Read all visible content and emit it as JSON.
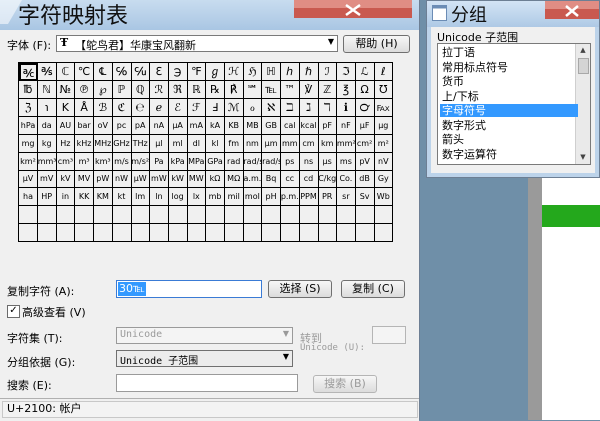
{
  "main_window": {
    "title": "字符映射表",
    "font_label": "字体 (F):",
    "font_icon": "Ŧ",
    "font_name": "【鸵鸟君】华康宝风翻新",
    "help_button": "帮助 (H)",
    "copy_label": "复制字符 (A):",
    "copy_value": "30℡",
    "select_button": "选择 (S)",
    "copy_button": "复制 (C)",
    "advanced_label": "高级查看 (V)",
    "advanced_checked": "✓",
    "charset_label": "字符集 (T):",
    "charset_value": "Unicode",
    "goto_label": "转到",
    "goto_sub": "Unicode (U):",
    "groupby_label": "分组依据 (G):",
    "groupby_value": "Unicode 子范围",
    "search_label": "搜索 (E):",
    "search_value": "",
    "search_button": "搜索 (B)",
    "status": "U+2100: 帐户"
  },
  "grid_chars": [
    "℀",
    "℁",
    "ℂ",
    "℃",
    "℄",
    "℅",
    "℆",
    "ℇ",
    "℈",
    "℉",
    "ℊ",
    "ℋ",
    "ℌ",
    "ℍ",
    "ℎ",
    "ℏ",
    "ℐ",
    "ℑ",
    "ℒ",
    "ℓ",
    "℔",
    "ℕ",
    "№",
    "℗",
    "℘",
    "ℙ",
    "ℚ",
    "ℛ",
    "ℜ",
    "ℝ",
    "℞",
    "℟",
    "℠",
    "℡",
    "™",
    "℣",
    "ℤ",
    "℥",
    "Ω",
    "℧",
    "ℨ",
    "℩",
    "K",
    "Å",
    "ℬ",
    "ℭ",
    "℮",
    "ℯ",
    "ℰ",
    "ℱ",
    "Ⅎ",
    "ℳ",
    "ℴ",
    "ℵ",
    "ℶ",
    "ℷ",
    "ℸ",
    "ℹ",
    "℺",
    "℻",
    "hPa",
    "da",
    "AU",
    "bar",
    "oV",
    "pc",
    "pA",
    "nA",
    "μA",
    "mA",
    "kA",
    "KB",
    "MB",
    "GB",
    "cal",
    "kcal",
    "pF",
    "nF",
    "μF",
    "μg",
    "mg",
    "kg",
    "Hz",
    "kHz",
    "MHz",
    "GHz",
    "THz",
    "μl",
    "ml",
    "dl",
    "kl",
    "fm",
    "nm",
    "μm",
    "mm",
    "cm",
    "km",
    "mm²",
    "cm²",
    "m²",
    "km²",
    "mm³",
    "cm³",
    "m³",
    "km³",
    "m/s",
    "m/s²",
    "Pa",
    "kPa",
    "MPa",
    "GPa",
    "rad",
    "rad/s",
    "rad/s²",
    "ps",
    "ns",
    "μs",
    "ms",
    "pV",
    "nV",
    "μV",
    "mV",
    "kV",
    "MV",
    "pW",
    "nW",
    "μW",
    "mW",
    "kW",
    "MW",
    "kΩ",
    "MΩ",
    "a.m.",
    "Bq",
    "cc",
    "cd",
    "C/kg",
    "Co.",
    "dB",
    "Gy",
    "ha",
    "HP",
    "in",
    "KK",
    "KM",
    "kt",
    "lm",
    "ln",
    "log",
    "lx",
    "mb",
    "mil",
    "mol",
    "pH",
    "p.m.",
    "PPM",
    "PR",
    "sr",
    "Sv",
    "Wb",
    "",
    "",
    "",
    "",
    "",
    "",
    "",
    "",
    "",
    "",
    "",
    "",
    "",
    "",
    "",
    "",
    "",
    "",
    "",
    "",
    "",
    "",
    "",
    "",
    "",
    "",
    "",
    "",
    "",
    "",
    "",
    "",
    "",
    "",
    "",
    "",
    "",
    "",
    "",
    ""
  ],
  "selected_cell_index": 0,
  "group_window": {
    "title": "分组",
    "list_label": "Unicode 子范围",
    "items": [
      {
        "label": "拉丁语"
      },
      {
        "label": "常用标点符号"
      },
      {
        "label": "货币"
      },
      {
        "label": "上/下标"
      },
      {
        "label": "字母符号"
      },
      {
        "label": "数字形式"
      },
      {
        "label": "箭头"
      },
      {
        "label": "数字运算符"
      }
    ],
    "selected_index": 4
  },
  "colors": {
    "selection_blue": "#3399ff",
    "title_gradient_top": "#c8dcef",
    "desktop_green": "#24a81c"
  },
  "icons": {
    "title_glass": "glass-reflection-icon",
    "close": "close-icon",
    "group_window": "window-icon",
    "scroll_up": "arrow-up-icon",
    "scroll_down": "arrow-down-icon",
    "dropdown": "chevron-down-icon"
  }
}
